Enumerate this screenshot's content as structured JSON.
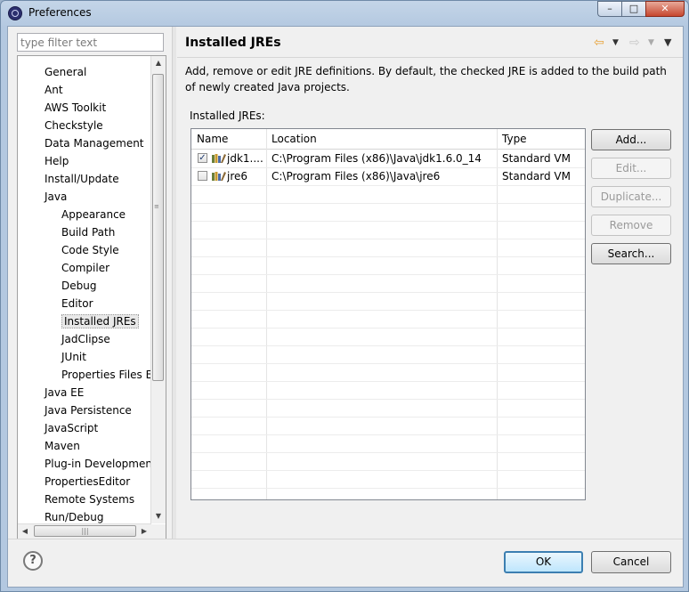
{
  "window": {
    "title": "Preferences",
    "controls": {
      "minimize": "–",
      "maximize": "□",
      "close": "✕"
    }
  },
  "filter": {
    "placeholder": "type filter text"
  },
  "tree": {
    "items": [
      {
        "label": "General",
        "level": 0
      },
      {
        "label": "Ant",
        "level": 0
      },
      {
        "label": "AWS Toolkit",
        "level": 0
      },
      {
        "label": "Checkstyle",
        "level": 0
      },
      {
        "label": "Data Management",
        "level": 0
      },
      {
        "label": "Help",
        "level": 0
      },
      {
        "label": "Install/Update",
        "level": 0
      },
      {
        "label": "Java",
        "level": 0
      },
      {
        "label": "Appearance",
        "level": 1
      },
      {
        "label": "Build Path",
        "level": 1
      },
      {
        "label": "Code Style",
        "level": 1
      },
      {
        "label": "Compiler",
        "level": 1
      },
      {
        "label": "Debug",
        "level": 1
      },
      {
        "label": "Editor",
        "level": 1
      },
      {
        "label": "Installed JREs",
        "level": 1,
        "selected": true
      },
      {
        "label": "JadClipse",
        "level": 1
      },
      {
        "label": "JUnit",
        "level": 1
      },
      {
        "label": "Properties Files Ed",
        "level": 1
      },
      {
        "label": "Java EE",
        "level": 0
      },
      {
        "label": "Java Persistence",
        "level": 0
      },
      {
        "label": "JavaScript",
        "level": 0
      },
      {
        "label": "Maven",
        "level": 0
      },
      {
        "label": "Plug-in Development",
        "level": 0
      },
      {
        "label": "PropertiesEditor",
        "level": 0
      },
      {
        "label": "Remote Systems",
        "level": 0
      },
      {
        "label": "Run/Debug",
        "level": 0
      }
    ]
  },
  "page": {
    "title": "Installed JREs",
    "description": "Add, remove or edit JRE definitions. By default, the checked JRE is added to the build path of newly created Java projects.",
    "table_label": "Installed JREs:",
    "columns": [
      "Name",
      "Location",
      "Type"
    ],
    "rows": [
      {
        "checked": true,
        "name": "jdk1....",
        "location": "C:\\Program Files (x86)\\Java\\jdk1.6.0_14",
        "type": "Standard VM"
      },
      {
        "checked": false,
        "name": "jre6",
        "location": "C:\\Program Files (x86)\\Java\\jre6",
        "type": "Standard VM"
      }
    ],
    "buttons": {
      "add": "Add...",
      "edit": "Edit...",
      "duplicate": "Duplicate...",
      "remove": "Remove",
      "search": "Search..."
    }
  },
  "footer": {
    "help": "?",
    "ok": "OK",
    "cancel": "Cancel"
  },
  "colors": {
    "titlebar": "#b3c8e0",
    "dialog_bg": "#f0f0f0",
    "default_button_border": "#3c7fb1",
    "nav_back_arrow": "#e8a33a"
  }
}
